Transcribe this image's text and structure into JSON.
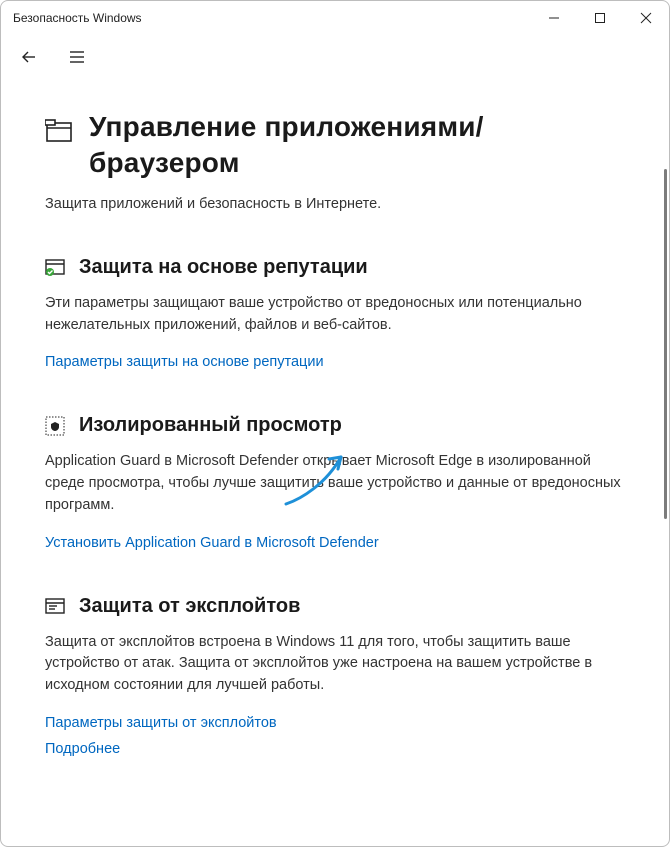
{
  "window": {
    "title": "Безопасность Windows"
  },
  "page": {
    "heading": "Управление приложениями/браузером",
    "subtitle": "Защита приложений и безопасность в Интернете."
  },
  "sections": {
    "reputation": {
      "title": "Защита на основе репутации",
      "desc": "Эти параметры защищают ваше устройство от вредоносных или потенциально нежелательных приложений, файлов и веб-сайтов.",
      "link": "Параметры защиты на основе репутации"
    },
    "isolated": {
      "title": "Изолированный просмотр",
      "desc": "Application Guard в Microsoft Defender открывает Microsoft Edge в изолированной среде просмотра, чтобы лучше защитить ваше устройство и данные от вредоносных программ.",
      "link": "Установить Application Guard в Microsoft Defender"
    },
    "exploit": {
      "title": "Защита от эксплойтов",
      "desc": "Защита от эксплойтов встроена в Windows 11 для того, чтобы защитить ваше устройство от атак. Защита от эксплойтов уже настроена на вашем устройстве в исходном состоянии для лучшей работы.",
      "link1": "Параметры защиты от эксплойтов",
      "link2": "Подробнее"
    }
  }
}
